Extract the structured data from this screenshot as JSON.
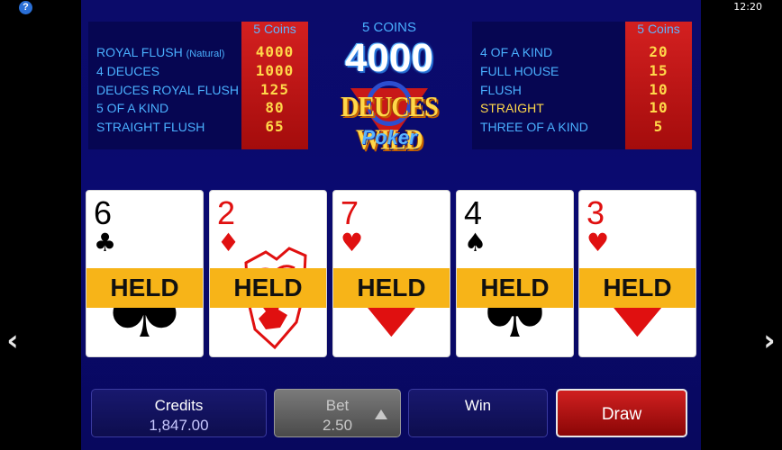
{
  "status": {
    "help_icon": "?",
    "clock": "12:20"
  },
  "nav": {
    "left_arrow": "‹",
    "right_arrow": "›"
  },
  "coins_label": "5 COINS",
  "coins_amount": "4000",
  "logo": {
    "title": "DEUCES WILD",
    "subtitle": "Poker"
  },
  "paytable_left": {
    "header": "5 Coins",
    "rows": [
      {
        "name": "ROYAL FLUSH",
        "note": "(Natural)",
        "value": "4000"
      },
      {
        "name": "4 DEUCES",
        "value": "1000"
      },
      {
        "name": "DEUCES ROYAL FLUSH",
        "value": "125"
      },
      {
        "name": "5 OF A KIND",
        "value": "80"
      },
      {
        "name": "STRAIGHT FLUSH",
        "value": "65"
      }
    ]
  },
  "paytable_right": {
    "header": "5 Coins",
    "rows": [
      {
        "name": "4 OF A KIND",
        "value": "20"
      },
      {
        "name": "FULL HOUSE",
        "value": "15"
      },
      {
        "name": "FLUSH",
        "value": "10"
      },
      {
        "name": "STRAIGHT",
        "value": "10",
        "highlight": true
      },
      {
        "name": "THREE OF A KIND",
        "value": "5"
      }
    ]
  },
  "cards": [
    {
      "rank": "6",
      "suit": "♣",
      "color": "black",
      "held_label": "HELD"
    },
    {
      "rank": "2",
      "suit": "♦",
      "color": "red",
      "held_label": "HELD"
    },
    {
      "rank": "7",
      "suit": "♥",
      "color": "red",
      "held_label": "HELD"
    },
    {
      "rank": "4",
      "suit": "♠",
      "color": "black",
      "held_label": "HELD"
    },
    {
      "rank": "3",
      "suit": "♥",
      "color": "red",
      "held_label": "HELD"
    }
  ],
  "buttons": {
    "credits": {
      "label": "Credits",
      "value": "1,847.00"
    },
    "bet": {
      "label": "Bet",
      "value": "2.50"
    },
    "win": {
      "label": "Win"
    },
    "draw": {
      "label": "Draw"
    }
  },
  "colors": {
    "table_bg": "#0a0a70",
    "held_bar": "#f7b418",
    "paytable_value": "#ffd84a",
    "paytable_name": "#4ab0ff"
  }
}
